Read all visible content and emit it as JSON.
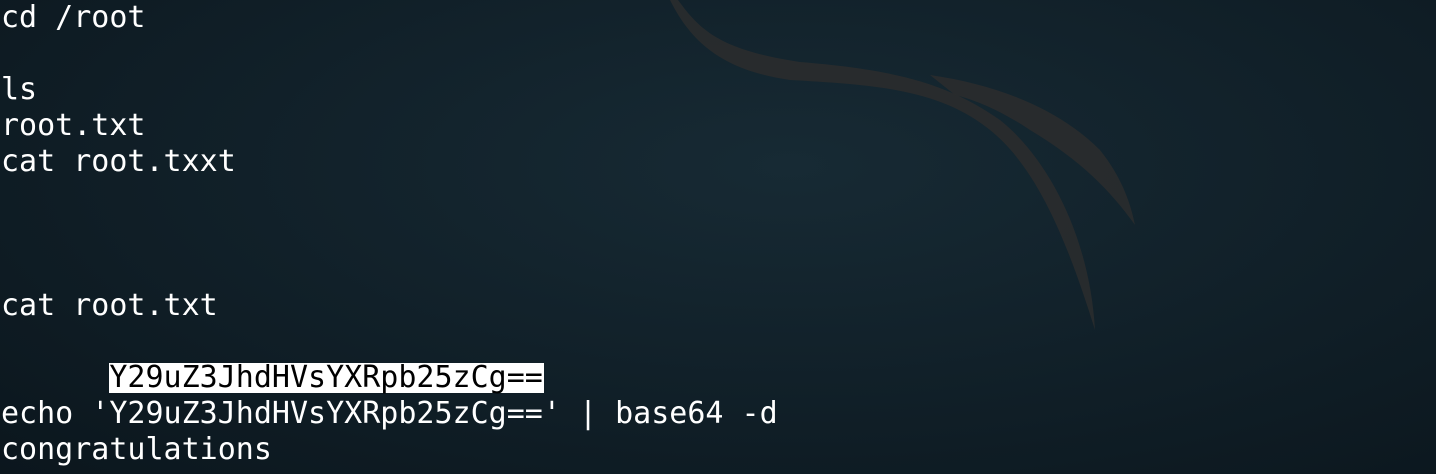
{
  "terminal": {
    "lines": [
      "cd /root",
      "",
      "ls",
      "root.txt",
      "cat root.txxt",
      "",
      "",
      "",
      "cat root.txt",
      "Y29uZ3JhdHVsYXRpb25zCg==",
      "",
      "echo 'Y29uZ3JhdHVsYXRpb25zCg==' | base64 -d",
      "congratulations"
    ],
    "selected_line_index": 9
  },
  "colors": {
    "background": "#0f1c24",
    "text": "#ffffff",
    "selection_bg": "#ffffff",
    "selection_fg": "#000000",
    "wallpaper_mark": "#2a2c2e"
  },
  "wallpaper": {
    "icon": "kali-dragon-claw-icon"
  }
}
